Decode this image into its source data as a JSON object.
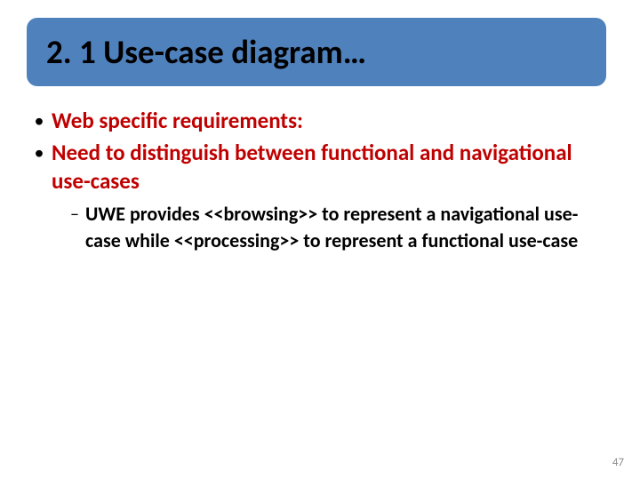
{
  "title": "2. 1 Use-case diagram…",
  "bullets": {
    "b1": "Web specific requirements:",
    "b2": "Need to distinguish between functional and navigational use-cases",
    "sub1": "UWE provides <<browsing>> to represent a navigational use-case while <<processing>> to represent a functional use-case"
  },
  "glyphs": {
    "dot": "•",
    "dash": "–"
  },
  "page_number": "47"
}
